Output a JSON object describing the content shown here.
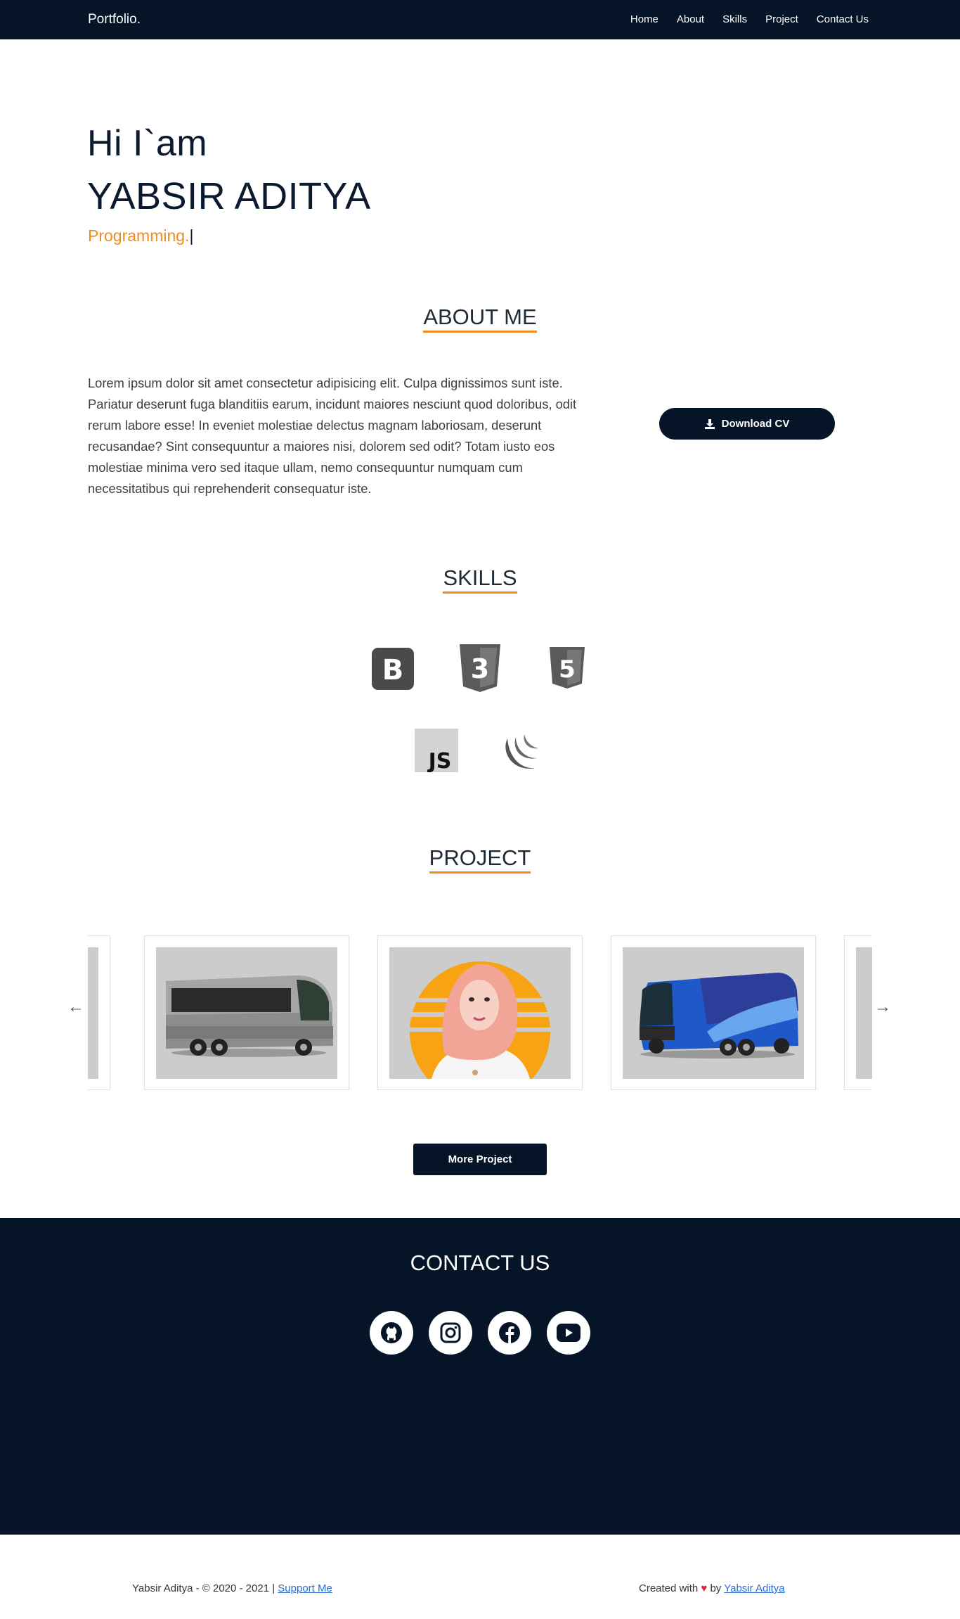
{
  "nav": {
    "brand": "Portfolio.",
    "links": [
      "Home",
      "About",
      "Skills",
      "Project",
      "Contact Us"
    ]
  },
  "hero": {
    "greeting": "Hi I`am",
    "name": "YABSIR ADITYA",
    "role": "Programming.",
    "cursor": "|"
  },
  "about": {
    "title": "ABOUT ME",
    "text": "Lorem ipsum dolor sit amet consectetur adipisicing elit. Culpa dignissimos sunt iste. Pariatur deserunt fuga blanditiis earum, incidunt maiores nesciunt quod doloribus, odit rerum labore esse! In eveniet molestiae delectus magnam laboriosam, deserunt recusandae? Sint consequuntur a maiores nisi, dolorem sed odit? Totam iusto eos molestiae minima vero sed itaque ullam, nemo consequuntur numquam cum necessitatibus qui reprehenderit consequatur iste.",
    "cv_button": "Download CV",
    "cv_icon": "download-icon"
  },
  "skills": {
    "title": "SKILLS",
    "items": [
      {
        "icon": "bootstrap-icon",
        "text": "B"
      },
      {
        "icon": "css3-icon",
        "text": "3"
      },
      {
        "icon": "html5-icon",
        "text": "5"
      },
      {
        "icon": "javascript-icon",
        "text": "JS"
      },
      {
        "icon": "jquery-icon",
        "text": ""
      }
    ]
  },
  "project": {
    "title": "PROJECT",
    "cards": [
      {
        "image": "partial-card"
      },
      {
        "image": "silver-bus"
      },
      {
        "image": "portrait-hijab"
      },
      {
        "image": "blue-bus"
      },
      {
        "image": "partial-card"
      }
    ],
    "prev_arrow": "←",
    "next_arrow": "→",
    "more_button": "More Project"
  },
  "contact": {
    "title": "CONTACT US",
    "socials": [
      "github-icon",
      "instagram-icon",
      "facebook-icon",
      "youtube-icon"
    ]
  },
  "footer": {
    "left_text": "Yabsir Aditya - © 2020 - 2021 |",
    "support_link": "Support Me",
    "created_text": "Created with",
    "heart": "♥",
    "by_text": "by",
    "author_link": "Yabsir Aditya"
  },
  "colors": {
    "navy": "#051426",
    "accent": "#f08c1e"
  }
}
